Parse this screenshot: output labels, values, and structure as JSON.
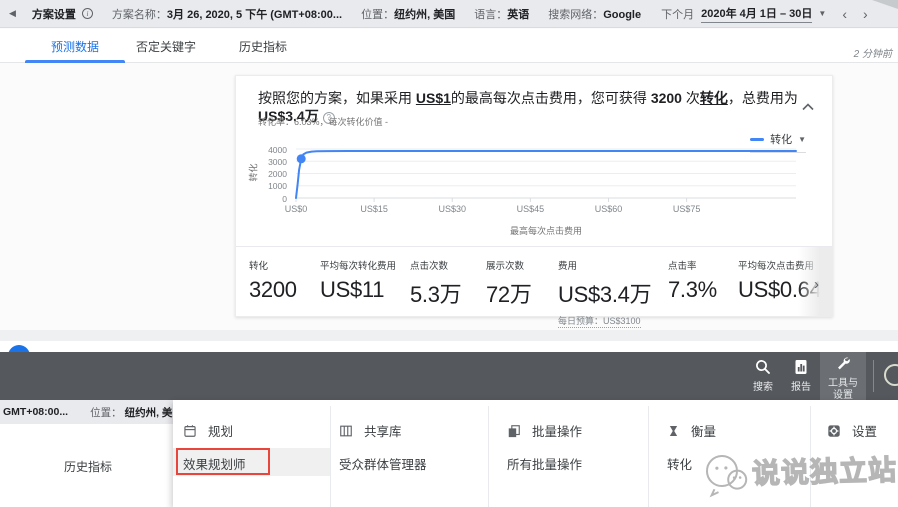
{
  "topbar": {
    "title": "方案设置",
    "fields": [
      {
        "label": "方案名称：",
        "value": "3月 26, 2020, 5 下午 (GMT+08:00..."
      },
      {
        "label": "位置：",
        "value": "纽约州, 美国"
      },
      {
        "label": "语言：",
        "value": "英语"
      },
      {
        "label": "搜索网络：",
        "value": "Google"
      }
    ],
    "period_label": "下个月",
    "period_value": "2020年 4月 1日 – 30日"
  },
  "tabs": {
    "forecast": "预测数据",
    "negative_keywords": "否定关键字",
    "history": "历史指标"
  },
  "updated_text": "2 分钟前",
  "card": {
    "headline": {
      "p0": "按照您的方案，如果采用 ",
      "p1": "US$1",
      "p2": "的最高每次点击费用，您可获得 ",
      "p3": "3200",
      "p4": " 次",
      "p5": "转化",
      "p6": "，总费用为 ",
      "p7": "US$3.4万"
    },
    "help_glyph": "?",
    "subline": "转化率：6.03%，每次转化价值 -",
    "legend_label": "转化",
    "metrics": [
      {
        "label": "转化",
        "value": "3200"
      },
      {
        "label": "平均每次转化费用",
        "value": "US$11"
      },
      {
        "label": "点击次数",
        "value": "5.3万"
      },
      {
        "label": "展示次数",
        "value": "72万"
      },
      {
        "label": "费用",
        "value": "US$3.4万",
        "note": "每日预算：US$3100"
      },
      {
        "label": "点击率",
        "value": "7.3%"
      },
      {
        "label": "平均每次点击费用",
        "value": "US$0.64"
      }
    ]
  },
  "chart_data": {
    "type": "line",
    "title": "",
    "xlabel": "最高每次点击费用",
    "ylabel": "转化",
    "x_ticks": [
      "US$0",
      "US$15",
      "US$30",
      "US$45",
      "US$60",
      "US$75"
    ],
    "x_tick_values": [
      0,
      15,
      30,
      45,
      60,
      75
    ],
    "x_max": 96,
    "ylim": [
      0,
      4000
    ],
    "y_ticks": [
      0,
      1000,
      2000,
      3000,
      4000
    ],
    "grid": "horizontal",
    "legend_position": "top-right",
    "line_color": "#4285f4",
    "series": [
      {
        "name": "转化",
        "x": [
          0,
          0.3,
          0.6,
          1.0,
          1.4,
          2,
          3,
          4,
          6,
          10,
          20,
          40,
          96
        ],
        "values": [
          0,
          1100,
          2300,
          3200,
          3560,
          3710,
          3790,
          3810,
          3825,
          3840,
          3840,
          3840,
          3840
        ]
      }
    ],
    "selected_point": {
      "x": 1,
      "y": 3200
    }
  },
  "dock": {
    "search_label": "搜索",
    "report_label": "报告",
    "tools_line1": "工具与",
    "tools_line2": "设置"
  },
  "background_page": {
    "gmt_text": "GMT+08:00...",
    "location_label": "位置：",
    "location_value": "纽约州, 美",
    "tab": "历史指标"
  },
  "menu": {
    "columns": [
      {
        "header": "规划",
        "items": [
          "效果规划师"
        ]
      },
      {
        "header": "共享库",
        "items": [
          "受众群体管理器"
        ]
      },
      {
        "header": "批量操作",
        "items": [
          "所有批量操作"
        ]
      },
      {
        "header": "衡量",
        "items": [
          "转化"
        ]
      },
      {
        "header": "设置",
        "items": []
      }
    ]
  },
  "watermark_text": "说说独立站",
  "icons": [
    "back-icon",
    "info-icon",
    "calendar-dropdown-icon",
    "prev-icon",
    "next-icon",
    "help-icon",
    "collapse-icon",
    "legend-dropdown-icon",
    "search-icon",
    "report-icon",
    "wrench-icon",
    "account-icon",
    "planning-icon",
    "shared-library-icon",
    "bulk-actions-icon",
    "measurement-icon",
    "settings-icon",
    "wechat-logo-icon"
  ]
}
